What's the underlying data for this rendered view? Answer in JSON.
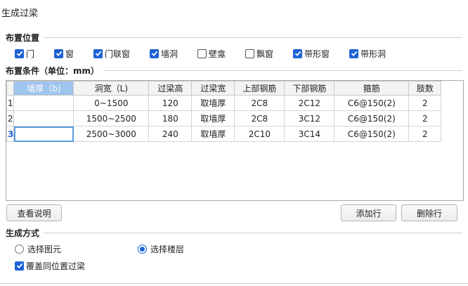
{
  "dialog": {
    "title": "生成过梁"
  },
  "placement": {
    "section_title": "布置位置",
    "options": [
      {
        "label": "门",
        "checked": true
      },
      {
        "label": "窗",
        "checked": true
      },
      {
        "label": "门联窗",
        "checked": true
      },
      {
        "label": "墙洞",
        "checked": true
      },
      {
        "label": "壁龛",
        "checked": false
      },
      {
        "label": "飘窗",
        "checked": false
      },
      {
        "label": "带形窗",
        "checked": true
      },
      {
        "label": "带形洞",
        "checked": true
      }
    ]
  },
  "conditions": {
    "section_title": "布置条件（单位：mm）",
    "columns": [
      "墙厚（b)",
      "洞宽（L)",
      "过梁高",
      "过梁宽",
      "上部钢筋",
      "下部钢筋",
      "箍筋",
      "肢数"
    ],
    "rows": [
      {
        "num": "1",
        "cells": [
          "",
          "0~1500",
          "120",
          "取墙厚",
          "2C8",
          "2C12",
          "C6@150(2)",
          "2"
        ]
      },
      {
        "num": "2",
        "cells": [
          "",
          "1500~2500",
          "180",
          "取墙厚",
          "2C8",
          "3C12",
          "C6@150(2)",
          "2"
        ]
      },
      {
        "num": "3",
        "cells": [
          "",
          "2500~3000",
          "240",
          "取墙厚",
          "2C10",
          "3C14",
          "C6@150(2)",
          "2"
        ]
      }
    ]
  },
  "buttons": {
    "view_help": "查看说明",
    "add_row": "添加行",
    "delete_row": "删除行"
  },
  "generation": {
    "section_title": "生成方式",
    "radio_element": "选择图元",
    "radio_floor": "选择楼层",
    "selected": "选择楼层",
    "overwrite_label": "覆盖同位置过梁",
    "overwrite_checked": true
  },
  "colors": {
    "accent": "#1e63d6",
    "active_header": "#9fc4ee"
  }
}
